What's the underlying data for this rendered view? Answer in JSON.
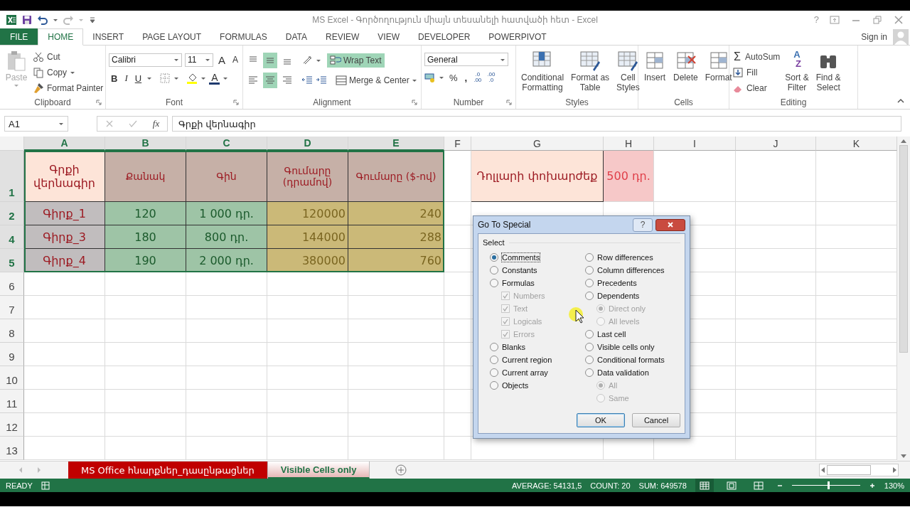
{
  "window": {
    "title": "MS Excel - Գործողություն միայն տեսանելի հատվածի հետ - Excel",
    "help": "?"
  },
  "ribbon_tabs": [
    {
      "label": "FILE",
      "kind": "file",
      "selected": false
    },
    {
      "label": "HOME",
      "kind": "tab",
      "selected": true
    },
    {
      "label": "INSERT",
      "kind": "tab",
      "selected": false
    },
    {
      "label": "PAGE LAYOUT",
      "kind": "tab",
      "selected": false
    },
    {
      "label": "FORMULAS",
      "kind": "tab",
      "selected": false
    },
    {
      "label": "DATA",
      "kind": "tab",
      "selected": false
    },
    {
      "label": "REVIEW",
      "kind": "tab",
      "selected": false
    },
    {
      "label": "VIEW",
      "kind": "tab",
      "selected": false
    },
    {
      "label": "DEVELOPER",
      "kind": "tab",
      "selected": false
    },
    {
      "label": "POWERPIVOT",
      "kind": "tab",
      "selected": false
    }
  ],
  "sign_in": "Sign in",
  "clipboard": {
    "name": "Clipboard",
    "paste": {
      "label": "Paste",
      "disabled": true
    },
    "cut": "Cut",
    "copy": "Copy",
    "format_painter": "Format Painter"
  },
  "font": {
    "name": "Font",
    "family": "Calibri",
    "size": "11",
    "grow": "A",
    "shrink": "A",
    "bold": "B",
    "italic": "I",
    "underline": "U",
    "font_color": "A"
  },
  "alignment": {
    "name": "Alignment",
    "valign": [
      {
        "selected": false
      },
      {
        "selected": true
      },
      {
        "selected": false
      }
    ],
    "halign": [
      {
        "selected": false
      },
      {
        "selected": true
      },
      {
        "selected": false
      }
    ],
    "wrap_text": {
      "label": "Wrap Text",
      "on": true
    },
    "merge": "Merge & Center"
  },
  "number": {
    "name": "Number",
    "format": "General",
    "percent": "%",
    "comma": ",",
    "decimals": [
      {
        "top": ".0",
        "bottom": ".00"
      },
      {
        "top": ".00",
        "bottom": ".0"
      }
    ]
  },
  "styles": {
    "name": "Styles",
    "buttons": [
      {
        "lines": [
          "Conditional",
          "Formatting"
        ]
      },
      {
        "lines": [
          "Format as",
          "Table"
        ]
      },
      {
        "lines": [
          "Cell",
          "Styles"
        ]
      }
    ]
  },
  "cells": {
    "name": "Cells",
    "buttons": [
      "Insert",
      "Delete",
      "Format"
    ]
  },
  "editing": {
    "name": "Editing",
    "autosum": {
      "symbol": "Σ",
      "label": "AutoSum"
    },
    "fill": "Fill",
    "clear": "Clear",
    "sort": {
      "letters": [
        "A",
        "Z"
      ],
      "lines": [
        "Sort &",
        "Filter"
      ]
    },
    "find": {
      "lines": [
        "Find &",
        "Select"
      ]
    }
  },
  "formula_bar": {
    "name_box": "A1",
    "fx": "fx",
    "formula": "Գրքի վերնագիր"
  },
  "sheet": {
    "columns": [
      {
        "label": "A",
        "selected": true
      },
      {
        "label": "B",
        "selected": true
      },
      {
        "label": "C",
        "selected": true
      },
      {
        "label": "D",
        "selected": true
      },
      {
        "label": "E",
        "selected": true
      },
      {
        "label": "F",
        "selected": false
      },
      {
        "label": "G",
        "selected": false
      },
      {
        "label": "H",
        "selected": false
      },
      {
        "label": "I",
        "selected": false
      },
      {
        "label": "J",
        "selected": false
      },
      {
        "label": "K",
        "selected": false
      }
    ],
    "rows": [
      {
        "label": "1",
        "selected": true,
        "cells": [
          {
            "text": "Գրքի վերնագիր",
            "kind": "header-light"
          },
          {
            "text": "Քանակ",
            "kind": "header"
          },
          {
            "text": "Գին",
            "kind": "header"
          },
          {
            "text": "Գումարը (դրամով)",
            "kind": "header"
          },
          {
            "text": "Գումարը ($-ով)",
            "kind": "header"
          },
          {
            "kind": "blank"
          },
          {
            "text": "Դոլլարի փոխարժեք",
            "kind": "header-light"
          },
          {
            "text": "500 դր.",
            "kind": "rate"
          }
        ]
      },
      {
        "label": "2",
        "selected": true,
        "cells": [
          {
            "text": "Գիրք_1",
            "kind": "name"
          },
          {
            "text": "120",
            "kind": "count"
          },
          {
            "text": "1 000 դր.",
            "kind": "count"
          },
          {
            "text": "120000",
            "kind": "sum"
          },
          {
            "text": "240",
            "kind": "sum"
          }
        ]
      },
      {
        "label": "4",
        "selected": true,
        "cells": [
          {
            "text": "Գիրք_3",
            "kind": "name"
          },
          {
            "text": "180",
            "kind": "count"
          },
          {
            "text": "800 դր.",
            "kind": "count"
          },
          {
            "text": "144000",
            "kind": "sum"
          },
          {
            "text": "288",
            "kind": "sum"
          }
        ]
      },
      {
        "label": "5",
        "selected": true,
        "cells": [
          {
            "text": "Գիրք_4",
            "kind": "name"
          },
          {
            "text": "190",
            "kind": "count"
          },
          {
            "text": "2 000 դր.",
            "kind": "count"
          },
          {
            "text": "380000",
            "kind": "sum"
          },
          {
            "text": "760",
            "kind": "sum"
          }
        ]
      },
      {
        "label": "6",
        "selected": false
      },
      {
        "label": "7",
        "selected": false
      },
      {
        "label": "8",
        "selected": false
      },
      {
        "label": "9",
        "selected": false
      },
      {
        "label": "10",
        "selected": false
      },
      {
        "label": "11",
        "selected": false
      },
      {
        "label": "12",
        "selected": false
      },
      {
        "label": "13",
        "selected": false
      }
    ]
  },
  "dialog": {
    "title": "Go To Special",
    "help": "?",
    "section": "Select",
    "columns": [
      [
        {
          "label": "Comments",
          "kind": "radio",
          "selected": true,
          "disabled": false
        },
        {
          "label": "Constants",
          "kind": "radio",
          "selected": false,
          "disabled": false
        },
        {
          "label": "Formulas",
          "kind": "radio",
          "selected": false,
          "disabled": false,
          "children": [
            {
              "label": "Numbers",
              "kind": "checkbox",
              "checked": true,
              "disabled": true
            },
            {
              "label": "Text",
              "kind": "checkbox",
              "checked": true,
              "disabled": true
            },
            {
              "label": "Logicals",
              "kind": "checkbox",
              "checked": true,
              "disabled": true
            },
            {
              "label": "Errors",
              "kind": "checkbox",
              "checked": true,
              "disabled": true
            }
          ]
        },
        {
          "label": "Blanks",
          "kind": "radio",
          "selected": false,
          "disabled": false
        },
        {
          "label": "Current region",
          "kind": "radio",
          "selected": false,
          "disabled": false
        },
        {
          "label": "Current array",
          "kind": "radio",
          "selected": false,
          "disabled": false
        },
        {
          "label": "Objects",
          "kind": "radio",
          "selected": false,
          "disabled": false
        }
      ],
      [
        {
          "label": "Row differences",
          "kind": "radio",
          "selected": false,
          "disabled": false
        },
        {
          "label": "Column differences",
          "kind": "radio",
          "selected": false,
          "disabled": false
        },
        {
          "label": "Precedents",
          "kind": "radio",
          "selected": false,
          "disabled": false
        },
        {
          "label": "Dependents",
          "kind": "radio",
          "selected": false,
          "disabled": false,
          "children": [
            {
              "label": "Direct only",
              "kind": "radio",
              "selected": true,
              "disabled": true
            },
            {
              "label": "All levels",
              "kind": "radio",
              "selected": false,
              "disabled": true
            }
          ]
        },
        {
          "label": "Last cell",
          "kind": "radio",
          "selected": false,
          "disabled": false
        },
        {
          "label": "Visible cells only",
          "kind": "radio",
          "selected": false,
          "disabled": false
        },
        {
          "label": "Conditional formats",
          "kind": "radio",
          "selected": false,
          "disabled": false
        },
        {
          "label": "Data validation",
          "kind": "radio",
          "selected": false,
          "disabled": false,
          "children": [
            {
              "label": "All",
              "kind": "radio",
              "selected": true,
              "disabled": true
            },
            {
              "label": "Same",
              "kind": "radio",
              "selected": false,
              "disabled": true
            }
          ]
        }
      ]
    ],
    "buttons": [
      {
        "label": "OK",
        "default": true
      },
      {
        "label": "Cancel",
        "default": false
      }
    ]
  },
  "sheet_tabs": [
    {
      "label": "MS Office հնարքներ_դասընթացներ",
      "selected": false,
      "color": "#c00000"
    },
    {
      "label": "Visible Cells only",
      "selected": true,
      "color": "#e6b8b7"
    }
  ],
  "status_bar": {
    "mode": "READY",
    "average": "AVERAGE: 54131,5",
    "count": "COUNT: 20",
    "sum": "SUM: 649578",
    "views": [
      {
        "selected": true
      },
      {
        "selected": false
      },
      {
        "selected": false
      }
    ],
    "zoom": {
      "level": 0.55,
      "reading": "130%"
    }
  }
}
